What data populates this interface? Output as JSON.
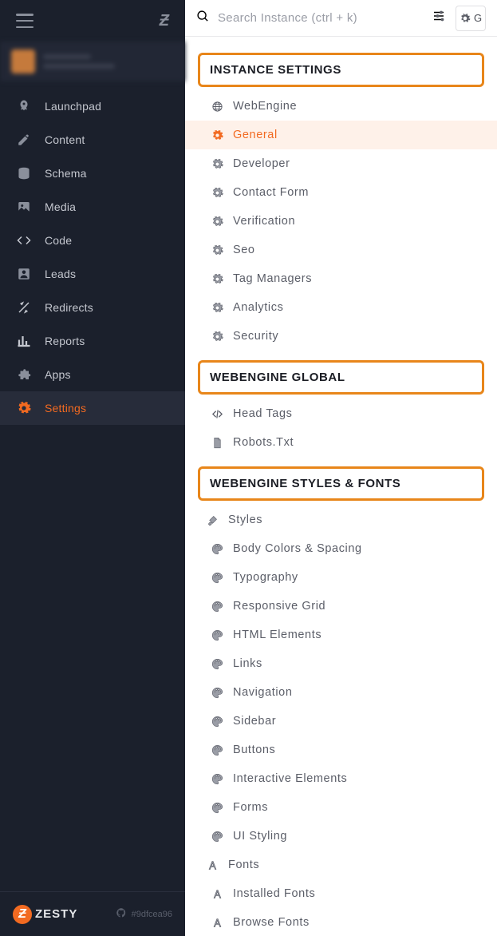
{
  "search": {
    "placeholder": "Search Instance (ctrl + k)"
  },
  "sidebar": {
    "items": [
      {
        "label": "Launchpad"
      },
      {
        "label": "Content"
      },
      {
        "label": "Schema"
      },
      {
        "label": "Media"
      },
      {
        "label": "Code"
      },
      {
        "label": "Leads"
      },
      {
        "label": "Redirects"
      },
      {
        "label": "Reports"
      },
      {
        "label": "Apps"
      },
      {
        "label": "Settings"
      }
    ],
    "brand_text": "ZESTY",
    "commit": "#9dfcea96"
  },
  "sections": {
    "instance": {
      "title": "INSTANCE SETTINGS",
      "items": [
        {
          "label": "WebEngine",
          "icon": "globe"
        },
        {
          "label": "General",
          "icon": "gear",
          "active": true
        },
        {
          "label": "Developer",
          "icon": "gear"
        },
        {
          "label": "Contact Form",
          "icon": "gear"
        },
        {
          "label": "Verification",
          "icon": "gear"
        },
        {
          "label": "Seo",
          "icon": "gear"
        },
        {
          "label": "Tag Managers",
          "icon": "gear"
        },
        {
          "label": "Analytics",
          "icon": "gear"
        },
        {
          "label": "Security",
          "icon": "gear"
        }
      ]
    },
    "global": {
      "title": "WEBENGINE GLOBAL",
      "items": [
        {
          "label": "Head Tags",
          "icon": "code"
        },
        {
          "label": "Robots.Txt",
          "icon": "file"
        }
      ]
    },
    "styles": {
      "title": "WEBENGINE STYLES & FONTS",
      "items": [
        {
          "label": "Styles",
          "icon": "brush",
          "parent": true
        },
        {
          "label": "Body Colors & Spacing",
          "icon": "palette"
        },
        {
          "label": "Typography",
          "icon": "palette"
        },
        {
          "label": "Responsive Grid",
          "icon": "palette"
        },
        {
          "label": "HTML Elements",
          "icon": "palette"
        },
        {
          "label": "Links",
          "icon": "palette"
        },
        {
          "label": "Navigation",
          "icon": "palette"
        },
        {
          "label": "Sidebar",
          "icon": "palette"
        },
        {
          "label": "Buttons",
          "icon": "palette"
        },
        {
          "label": "Interactive Elements",
          "icon": "palette"
        },
        {
          "label": "Forms",
          "icon": "palette"
        },
        {
          "label": "UI Styling",
          "icon": "palette"
        },
        {
          "label": "Fonts",
          "icon": "font",
          "parent": true
        },
        {
          "label": "Installed Fonts",
          "icon": "font"
        },
        {
          "label": "Browse Fonts",
          "icon": "font"
        }
      ]
    }
  }
}
